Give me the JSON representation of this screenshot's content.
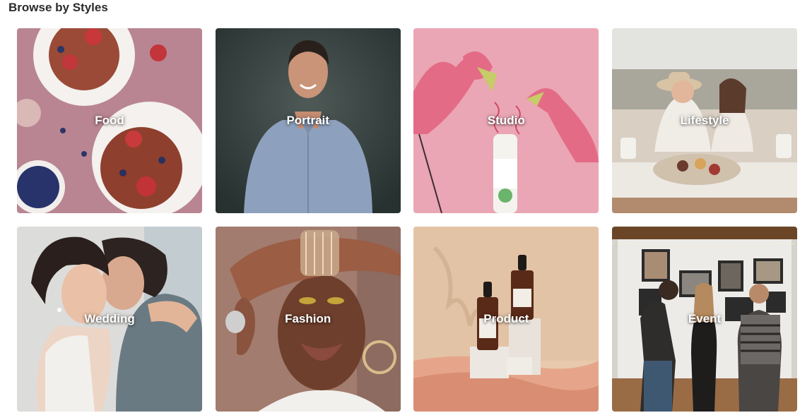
{
  "page": {
    "title": "Browse by Styles"
  },
  "styles": [
    {
      "label": "Food"
    },
    {
      "label": "Portrait"
    },
    {
      "label": "Studio"
    },
    {
      "label": "Lifestyle"
    },
    {
      "label": "Wedding"
    },
    {
      "label": "Fashion"
    },
    {
      "label": "Product"
    },
    {
      "label": "Event"
    }
  ],
  "colors": {
    "title_text": "#2b2b2b",
    "label_text": "#ffffff"
  }
}
